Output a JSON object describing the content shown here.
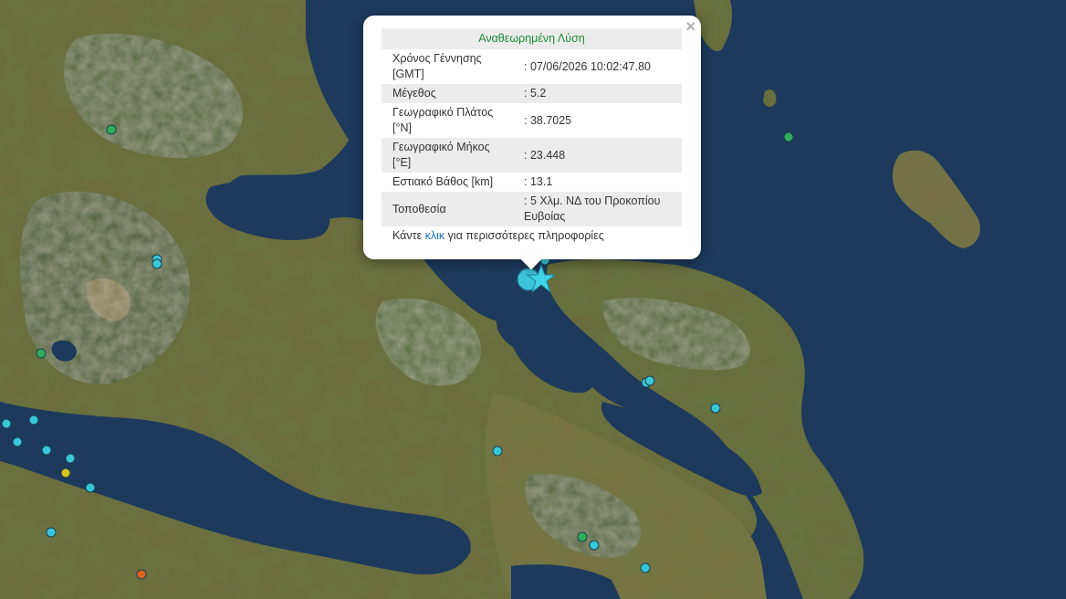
{
  "popup": {
    "title": "Αναθεωρημένη Λύση",
    "close_symbol": "×",
    "rows": [
      {
        "label": "Χρόνος Γέννησης [GMT]",
        "value": ": 07/06/2026 10:02:47.80"
      },
      {
        "label": "Μέγεθος",
        "value": ": 5.2"
      },
      {
        "label": "Γεωγραφικό Πλάτος [°N]",
        "value": ": 38.7025"
      },
      {
        "label": "Γεωγραφικό Μήκος [°E]",
        "value": ": 23.448"
      },
      {
        "label": "Εστιακό Βάθος [km]",
        "value": ": 13.1"
      },
      {
        "label": "Τοποθεσία",
        "value": ": 5 Χλμ. ΝΔ του Προκοπίου Ευβοίας"
      }
    ],
    "more_prefix": "Κάντε",
    "more_link": "κλικ",
    "more_suffix": "για περισσότερες πληροφορίες"
  },
  "colors": {
    "sea": "#1d3a5c",
    "land": "#6e6a3e",
    "forest": "#3f5a2c",
    "marker_cyan": "#39c6d8",
    "marker_green": "#2fae5a",
    "marker_yellow": "#d8c21e",
    "marker_orange": "#e0621e",
    "marker_outline": "#17424f",
    "epicenter": "#3fd3e8",
    "title_green": "#1f8a3b",
    "link_blue": "#1a6fc2"
  },
  "epicenter_icon": "star-icon"
}
